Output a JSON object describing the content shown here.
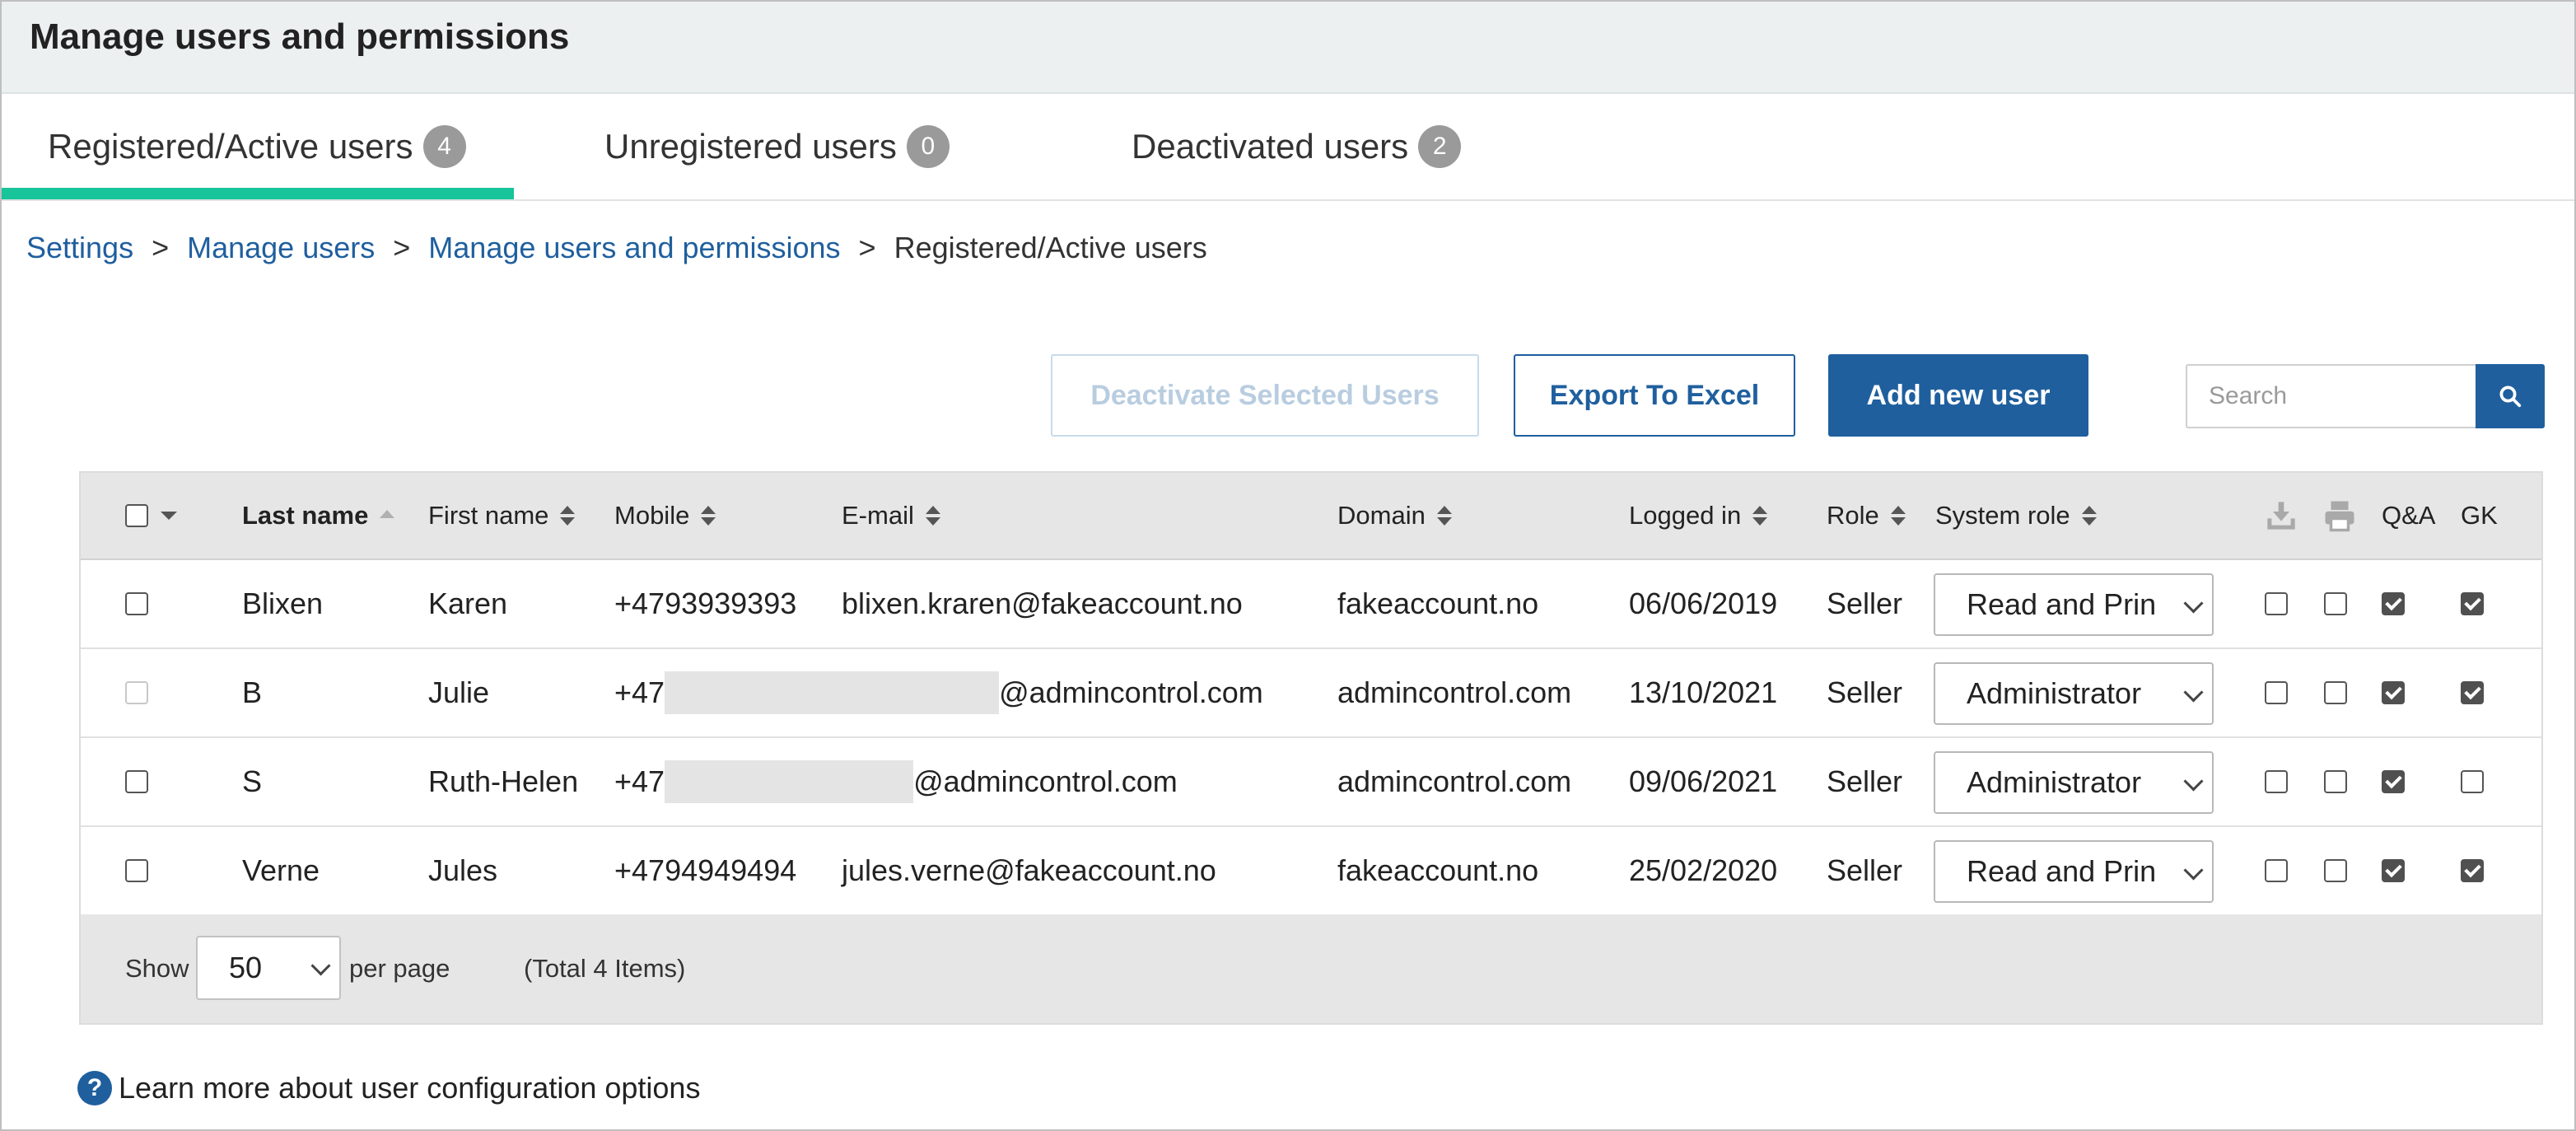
{
  "page": {
    "title": "Manage users and permissions"
  },
  "tabs": [
    {
      "label": "Registered/Active users",
      "count": "4"
    },
    {
      "label": "Unregistered users",
      "count": "0"
    },
    {
      "label": "Deactivated users",
      "count": "2"
    }
  ],
  "breadcrumb": {
    "items": [
      "Settings",
      "Manage users",
      "Manage users and permissions"
    ],
    "current": "Registered/Active users",
    "separator": ">"
  },
  "actions": {
    "deactivate": "Deactivate Selected Users",
    "export": "Export To Excel",
    "add": "Add new user"
  },
  "search": {
    "placeholder": "Search"
  },
  "table": {
    "columns": [
      "Last name",
      "First name",
      "Mobile",
      "E-mail",
      "Domain",
      "Logged in",
      "Role",
      "System role",
      "Q&A",
      "GK"
    ],
    "icon_columns": [
      "download-icon",
      "print-icon"
    ],
    "rows": [
      {
        "last": "Blixen",
        "first": "Karen",
        "mobile": "+4793939393",
        "email": "blixen.kraren@fakeaccount.no",
        "domain": "fakeaccount.no",
        "logged": "06/06/2019",
        "role": "Seller",
        "system_role": "Read and Prin",
        "dl": false,
        "print": false,
        "qa": true,
        "gk": true
      },
      {
        "last": "B",
        "first": "Julie",
        "mobile": "+47",
        "email": "@admincontrol.com",
        "domain": "admincontrol.com",
        "logged": "13/10/2021",
        "role": "Seller",
        "system_role": "Administrator",
        "dl": false,
        "print": false,
        "qa": true,
        "gk": true
      },
      {
        "last": "S",
        "first": "Ruth-Helen",
        "mobile": "+47",
        "email": "@admincontrol.com",
        "domain": "admincontrol.com",
        "logged": "09/06/2021",
        "role": "Seller",
        "system_role": "Administrator",
        "dl": false,
        "print": false,
        "qa": true,
        "gk": false
      },
      {
        "last": "Verne",
        "first": "Jules",
        "mobile": "+4794949494",
        "email": "jules.verne@fakeaccount.no",
        "domain": "fakeaccount.no",
        "logged": "25/02/2020",
        "role": "Seller",
        "system_role": "Read and Prin",
        "dl": false,
        "print": false,
        "qa": true,
        "gk": true
      }
    ]
  },
  "footer": {
    "show_label": "Show",
    "per_page_value": "50",
    "per_page_label": "per page",
    "total": "(Total 4 Items)"
  },
  "help": {
    "label": "Learn more about user configuration options"
  },
  "colors": {
    "accent": "#1f5f9e",
    "tab_indicator": "#18c49a"
  }
}
